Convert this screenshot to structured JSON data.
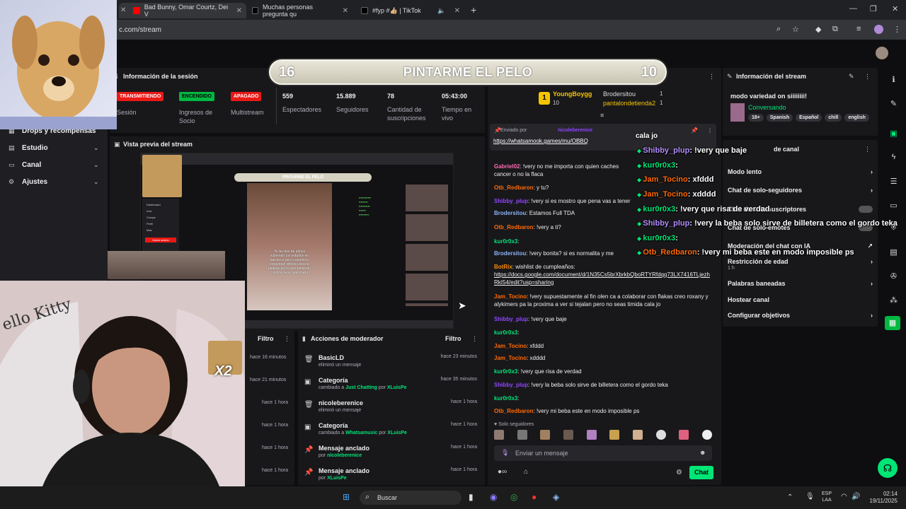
{
  "browser": {
    "tabs": [
      {
        "label": "Bad Bunny, Omar Courtz, Dei V",
        "color": "#ff0000"
      },
      {
        "label": "Muchas personas pregunta qu",
        "color": "#111111"
      },
      {
        "label": "#fyp #👍🏼 | TikTok",
        "color": "#111111"
      }
    ],
    "url": "c.com/stream"
  },
  "banner": {
    "left": "16",
    "title": "PINTARME EL PELO",
    "right": "10"
  },
  "session": {
    "title": "Información de la sesión",
    "badges": [
      {
        "label": "TRANSMITIENDO",
        "color": "#e91916",
        "caption": "Sesión"
      },
      {
        "label": "ENCENDIDO",
        "color": "#00b842",
        "caption": "Ingresos de Socio"
      },
      {
        "label": "APAGADO",
        "color": "#e91916",
        "caption": "Multistream"
      }
    ],
    "stats": [
      {
        "value": "559",
        "label": "Espectadores"
      },
      {
        "value": "15.889",
        "label": "Seguidores"
      },
      {
        "value": "78",
        "label": "Cantidad de suscripciones"
      },
      {
        "value": "05:43:00",
        "label": "Tiempo en vivo"
      }
    ]
  },
  "sidebar": {
    "items": [
      {
        "label": "Drops y recompensas"
      },
      {
        "label": "Estudio"
      },
      {
        "label": "Canal"
      },
      {
        "label": "Ajustes"
      }
    ]
  },
  "preview": {
    "title": "Vista previa del stream",
    "mini_title": "PINTARME EL PELO",
    "mini_caption": "Te las das de pituca subiendo tus estados en barranco pero cuando te preguntan dónde vives te palteas pq tu asentamiento ni pista tiene ,alucinada",
    "mini_menu": [
      "Dashboard",
      "Live",
      "Comps",
      "Perfil",
      "Mas"
    ],
    "mini_button": "Iniciar sesión"
  },
  "overlay": {
    "x2": "X2"
  },
  "activity": {
    "filter_label": "Filtro",
    "times": [
      "hace 16 minutos",
      "hace 21 minutos",
      "hace 1 hora",
      "hace 1 hora",
      "hace 1 hora",
      "hace 1 hora"
    ]
  },
  "mod_actions": {
    "title": "Acciones de moderador",
    "filter_label": "Filtro",
    "items": [
      {
        "name": "BasicLD",
        "desc": "eliminó un mensaje",
        "time": "hace 23 minutos",
        "icon": "trash-icon",
        "glyph": "🗑"
      },
      {
        "name": "Categoría",
        "desc_a": "cambiado a ",
        "target": "Just Chatting",
        "desc_b": " por ",
        "who": "XLuisPe",
        "time": "hace 35 minutos",
        "icon": "category-icon",
        "glyph": "▣"
      },
      {
        "name": "nicoleberenice",
        "desc": "eliminó un mensaje",
        "time": "hace 1 hora",
        "icon": "trash-icon",
        "glyph": "🗑"
      },
      {
        "name": "Categoría",
        "desc_a": "cambiado a ",
        "target": "Whatsamusic",
        "desc_b": " por ",
        "who": "XLuisPe",
        "time": "hace 1 hora",
        "icon": "category-icon",
        "glyph": "▣"
      },
      {
        "name": "Mensaje anclado",
        "desc_a": "por ",
        "who": "nicoleberenice",
        "time": "hace 1 hora",
        "icon": "pin-icon",
        "glyph": "📌"
      },
      {
        "name": "Mensaje anclado",
        "desc_a": "por ",
        "who": "XLuisPe",
        "time": "hace 1 hora",
        "icon": "pin-icon",
        "glyph": "📌"
      }
    ]
  },
  "chat": {
    "leaderboard": [
      {
        "rank": "1",
        "name": "YoungBoygg",
        "value": "10"
      },
      {
        "name": "Brodersitou",
        "value": "1"
      },
      {
        "name": "pantalondetienda2",
        "value": "1"
      }
    ],
    "pinned": {
      "label": "Enviado por",
      "user": "nicoleberenice",
      "link": "https://whatsamook.games/mu/OBBQ"
    },
    "messages": [
      {
        "user": "Gabriel02",
        "color": "#ff69b4",
        "text": ": !very no me importa con quien caches",
        "cont": "cancer o no la flaca"
      },
      {
        "user": "Otb_Redbaron",
        "color": "#ff6905",
        "text": ": y tu?"
      },
      {
        "user": "Shibby_plup",
        "color": "#9146ff",
        "text": ": !very si es mostro que pena vas a tener"
      },
      {
        "user": "Brodersitou",
        "color": "#8ab4f8",
        "text": ": Estamos Full TDA"
      },
      {
        "user": "Otb_Redbaron",
        "color": "#ff6905",
        "text": ": !very a ti?"
      },
      {
        "user": "kur0r0x3",
        "color": "#00e676",
        "text": ":"
      },
      {
        "user": "Brodersitou",
        "color": "#8ab4f8",
        "text": ": !very bonita? si es normalita y me"
      },
      {
        "user": "BotRix",
        "color": "#ff8c00",
        "text": ": wishlist de cumpleaños:",
        "link": "https://docs.google.com/document/d/1N35Cs5brXbrkbQboRTYRfdqq73LX7416TLjezhRkI54/edit?usp=sharing"
      },
      {
        "user": "Jam_Tocino",
        "color": "#ff6905",
        "text": ": !very supuestamente al fin olen ca a colaborar con flakas creo roxany y alykimers pa la proxima a ver si tejalan pero no seas timida cala jo"
      },
      {
        "user": "Shibby_plup",
        "color": "#9146ff",
        "text": ": !very que baje"
      },
      {
        "user": "kur0r0x3",
        "color": "#00e676",
        "text": ":"
      },
      {
        "user": "Jam_Tocino",
        "color": "#ff6905",
        "text": ": xfddd"
      },
      {
        "user": "Jam_Tocino",
        "color": "#ff6905",
        "text": ": xdddd"
      },
      {
        "user": "kur0r0x3",
        "color": "#00e676",
        "text": ": !very que risa de verdad"
      },
      {
        "user": "Shibby_plup",
        "color": "#9146ff",
        "text": ": !very la beba solo sirve de billetera como el gordo teka"
      },
      {
        "user": "kur0r0x3",
        "color": "#00e676",
        "text": ":"
      },
      {
        "user": "Otb_Redbaron",
        "color": "#ff6905",
        "text": ": !very mi beba este en modo imposible ps"
      }
    ],
    "followers_only": "Solo seguidores",
    "input_placeholder": "Enviar un mensaje",
    "send_label": "Chat"
  },
  "chat_overlay": {
    "header": "cala jo",
    "lines": [
      {
        "user": "Shibby_plup",
        "color": "#b38cff",
        "text": ": !very que baje"
      },
      {
        "user": "kur0r0x3",
        "color": "#00e676",
        "text": ":"
      },
      {
        "user": "Jam_Tocino",
        "color": "#ff6905",
        "text": ": xfddd"
      },
      {
        "user": "Jam_Tocino",
        "color": "#ff6905",
        "text": ": xdddd"
      },
      {
        "user": "kur0r0x3",
        "color": "#00e676",
        "text": ": !very que risa de verdad"
      },
      {
        "user": "Shibby_plup",
        "color": "#b38cff",
        "text": ": !very la beba solo sirve de billetera como el gordo teka"
      },
      {
        "user": "kur0r0x3",
        "color": "#00e676",
        "text": ":"
      },
      {
        "user": "Otb_Redbaron",
        "color": "#ff6905",
        "text": ": !very mi beba este en modo imposible ps"
      }
    ]
  },
  "stream_info": {
    "title": "Información del stream",
    "stream_title": "modo variedad on siiiiiiii!",
    "category": "Conversando",
    "tags": [
      "18+",
      "Spanish",
      "Español",
      "chill",
      "english"
    ]
  },
  "channel_mod": {
    "header_suffix": "de canal",
    "items": [
      {
        "label": "Modo lento",
        "chevron": true
      },
      {
        "label": "Chat de solo-seguidores",
        "chevron": true
      },
      {
        "label": "Chat de solo-suscriptores",
        "toggle": true
      },
      {
        "label": "Chat de solo-emotes",
        "toggle": true
      },
      {
        "label": "Moderación del chat con IA",
        "ext": true
      },
      {
        "label": "Restricción de edad",
        "sub": "1 h",
        "chevron": true
      },
      {
        "label": "Palabras baneadas",
        "chevron": true
      },
      {
        "label": "Hostear canal"
      },
      {
        "label": "Configurar objetivos",
        "chevron": true
      }
    ]
  },
  "taskbar": {
    "search_placeholder": "Buscar",
    "lang": "ESP",
    "lang_sub": "LAA",
    "time": "02:14",
    "date": "19/11/2025"
  },
  "colors": {
    "accent": "#00b842",
    "live": "#e91916",
    "purple": "#9146ff",
    "panel": "#18181b",
    "bg": "#0e0e10"
  }
}
